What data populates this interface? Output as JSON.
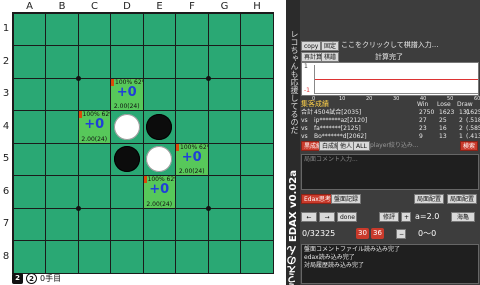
{
  "board": {
    "columns": [
      "A",
      "B",
      "C",
      "D",
      "E",
      "F",
      "G",
      "H"
    ],
    "rows": [
      "1",
      "2",
      "3",
      "4",
      "5",
      "6",
      "7",
      "8"
    ],
    "stones": [
      {
        "col": 3,
        "row": 3,
        "color": "white"
      },
      {
        "col": 4,
        "row": 3,
        "color": "black"
      },
      {
        "col": 3,
        "row": 4,
        "color": "black"
      },
      {
        "col": 4,
        "row": 4,
        "color": "white"
      }
    ],
    "hints": [
      {
        "col": 3,
        "row": 2,
        "top": "100% 62%",
        "eval": "+0",
        "bottom": "2.00(24)"
      },
      {
        "col": 2,
        "row": 3,
        "top": "100% 62%",
        "eval": "+0",
        "bottom": "2.00(24)"
      },
      {
        "col": 5,
        "row": 4,
        "top": "100% 62%",
        "eval": "+0",
        "bottom": "2.00(24)"
      },
      {
        "col": 4,
        "row": 5,
        "top": "100% 62%",
        "eval": "+0",
        "bottom": "2.00(24)"
      }
    ],
    "footer": {
      "black_count": "2",
      "white_count": "2",
      "move_label": "0手目"
    },
    "colors": {
      "board": "#2aa874",
      "hint": "#57c85a",
      "eval": "#1f3fd8"
    }
  },
  "panel": {
    "vertical_caption": "レコちゃんも応援してるのだ",
    "app_title": "うえのん EDAX v0.02a",
    "copy_btn": "copy",
    "fix_btn": "固定",
    "kifu_input_hint": "ここをクリックして棋譜入力...",
    "btn_calc": "再計算",
    "btn_kifu": "棋譜",
    "calc_status": "計算完了",
    "graph": {
      "y_top": "1",
      "y_bottom": "-1",
      "x_labels": [
        "0",
        "10",
        "20",
        "30",
        "40",
        "50",
        "60"
      ]
    },
    "stats": {
      "title": "集客成績",
      "header": [
        "Win",
        "Lose",
        "Draw"
      ],
      "rows": [
        {
          "label": "合計",
          "name": "4504試合[2035]",
          "win": "2750",
          "lose": "1623",
          "draw": "131",
          "pct": "(.625)"
        },
        {
          "label": "vs",
          "name": "ip*******az[2120]",
          "win": "27",
          "lose": "25",
          "draw": "2",
          "pct": "(.518)"
        },
        {
          "label": "vs",
          "name": "fa*******[2125]",
          "win": "23",
          "lose": "16",
          "draw": "2",
          "pct": "(.585)"
        },
        {
          "label": "vs",
          "name": "Bo*******d[2062]",
          "win": "9",
          "lose": "13",
          "draw": "1",
          "pct": "(.413)"
        }
      ]
    },
    "filters": {
      "tag1": "黒成績",
      "tag2": "白成績",
      "tag3": "他人",
      "tag4": "ALL",
      "player_hint": "player絞り込み...",
      "search_btn": "検索"
    },
    "comment_hint": "局面コメント入力...",
    "btn_edax": "Edax思考",
    "btn_diagram": "盤面記録",
    "btn_calc2": "局面配置",
    "btn_progress": "局面配置",
    "nav": {
      "prev": "←",
      "next": "→",
      "done": "done",
      "edit": "修評",
      "dir": "+",
      "alpha": "a=2.0",
      "range": "海亀"
    },
    "move_counter": "0/32325",
    "depth_a": "30",
    "depth_b": "36",
    "depth_range": "0〜0",
    "log": [
      "盤面コメントファイル読み込み完了",
      "edax読み込み完了",
      "対局履歴読み込み完了"
    ]
  }
}
